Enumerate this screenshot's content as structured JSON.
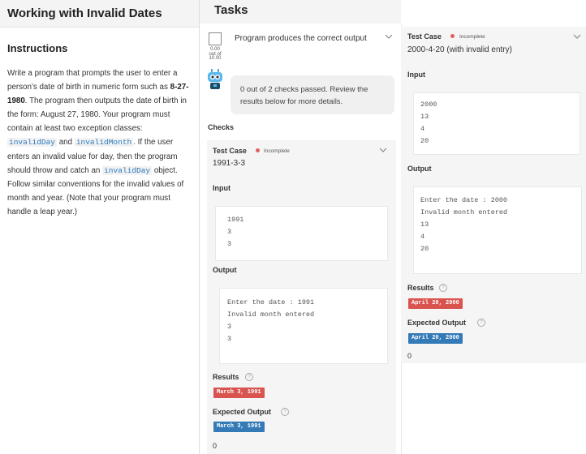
{
  "left": {
    "title": "Working with Invalid Dates",
    "instructions_heading": "Instructions",
    "instructions": {
      "p1": "Write a program that prompts the user to enter a person's date of birth in numeric form such as ",
      "example_date": "8-27-1980",
      "p2": ". The program then outputs the date of birth in the form: August 27, 1980. Your program must contain at least two exception classes: ",
      "class1": "invalidDay",
      "p3": " and ",
      "class2": "invalidMonth",
      "p4": ". If the user enters an invalid value for day, then the program should throw and catch an ",
      "class3": "invalidDay",
      "p5": " object. Follow similar conventions for the invalid values of month and year. (Note that your program must handle a leap year.)"
    }
  },
  "tasks": {
    "title": "Tasks",
    "task_label": "Program produces the correct output",
    "score_top": "0.00",
    "score_mid": "out of",
    "score_bottom": "10.00",
    "bubble": "0 out of 2 checks passed. Review the results below for more details.",
    "checks_label": "Checks"
  },
  "case1": {
    "label": "Test Case",
    "status": "Incomplete",
    "subtitle": "1991-3-3",
    "input_label": "Input",
    "input": "1991\n3\n3",
    "output_label": "Output",
    "output": "Enter the date : 1991\nInvalid month entered\n3\n3",
    "results_label": "Results",
    "result": "March 3, 1991",
    "expected_label": "Expected Output",
    "expected": "March 3, 1991",
    "trailing": "0"
  },
  "case2": {
    "label": "Test Case",
    "status": "Incomplete",
    "subtitle": "2000-4-20 (with invalid entry)",
    "input_label": "Input",
    "input": "2000\n13\n4\n20",
    "output_label": "Output",
    "output": "Enter the date : 2000\nInvalid month entered\n13\n4\n20",
    "results_label": "Results",
    "result": "April 20, 2000",
    "expected_label": "Expected Output",
    "expected": "April 20, 2000",
    "trailing": "0"
  },
  "icons": {
    "chevron": "chevron-down-icon",
    "help": "help-icon",
    "bot": "bot-icon"
  },
  "colors": {
    "incomplete_dot": "#e06060",
    "result_badge": "#d9534f",
    "expected_badge": "#337ab7",
    "code_text": "#2a7bbf"
  }
}
